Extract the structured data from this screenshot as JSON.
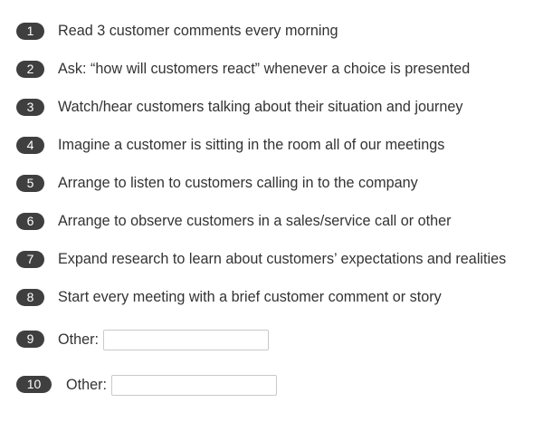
{
  "items": [
    {
      "number": "1",
      "label": "Read 3 customer comments every morning"
    },
    {
      "number": "2",
      "label": "Ask: “how will customers react” whenever a choice is presented"
    },
    {
      "number": "3",
      "label": "Watch/hear customers talking about their situation and journey"
    },
    {
      "number": "4",
      "label": "Imagine a customer is sitting in the room all of our meetings"
    },
    {
      "number": "5",
      "label": "Arrange to listen to customers calling in to the company"
    },
    {
      "number": "6",
      "label": "Arrange to observe customers in a sales/service call or other"
    },
    {
      "number": "7",
      "label": "Expand research to learn about customers’ expectations and realities"
    },
    {
      "number": "8",
      "label": "Start every meeting with a brief customer comment or story"
    }
  ],
  "other_items": [
    {
      "number": "9",
      "label": "Other:",
      "value": "",
      "placeholder": ""
    },
    {
      "number": "10",
      "label": "Other:",
      "value": "",
      "placeholder": ""
    }
  ],
  "colors": {
    "badge_bg": "#3f3f3f",
    "badge_text": "#ffffff",
    "text": "#333333",
    "input_border": "#c9c9c9"
  }
}
